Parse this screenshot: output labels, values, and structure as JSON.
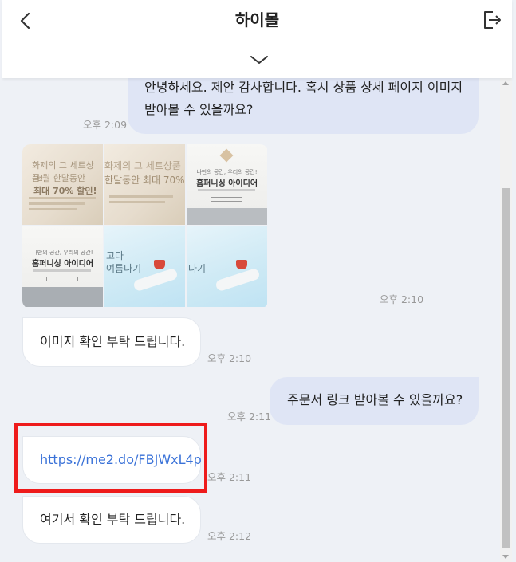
{
  "header": {
    "title": "하이몰",
    "back_icon": "chevron-left-icon",
    "exit_icon": "exit-icon",
    "collapse_icon": "chevron-down-icon"
  },
  "messages": [
    {
      "sender": "me",
      "lines": [
        "안녕하세요. 제안 감사합니다. 혹시 상품 상세 페이지 이미지",
        "받아볼 수 있을까요?"
      ],
      "time": "오후 2:09"
    },
    {
      "sender": "them",
      "type": "images",
      "time": "오후 2:10",
      "images": [
        {
          "lines": [
            "화제의 그 세트상품!",
            "6월 한달동안",
            "최대 70% 할인!"
          ]
        },
        {
          "lines": [
            "화제의 그 세트상품",
            "한달동안 최대 70%"
          ]
        },
        {
          "lines": [
            "나만의 공간, 우리의 공간!",
            "홈퍼니싱 아이디어"
          ]
        },
        {
          "lines": [
            "나만의 공간, 우리의 공간!",
            "홈퍼니싱 아이디어"
          ]
        },
        {
          "lines": [
            "고다",
            "여름나기"
          ]
        },
        {
          "lines": [
            "나기"
          ]
        }
      ]
    },
    {
      "sender": "them",
      "text": "이미지 확인 부탁 드립니다.",
      "time": "오후 2:10"
    },
    {
      "sender": "me",
      "text": "주문서 링크 받아볼 수 있을까요?",
      "time": "오후 2:11"
    },
    {
      "sender": "them",
      "text": "https://me2.do/FBJWxL4p",
      "time": "오후 2:11"
    },
    {
      "sender": "them",
      "text": "여기서 확인 부탁 드립니다.",
      "time": "오후 2:12"
    }
  ],
  "colors": {
    "background": "#eef1f6",
    "my_bubble": "#dfe5f5",
    "their_bubble": "#ffffff",
    "link": "#3a72d8",
    "highlight": "#ee1b1b"
  }
}
